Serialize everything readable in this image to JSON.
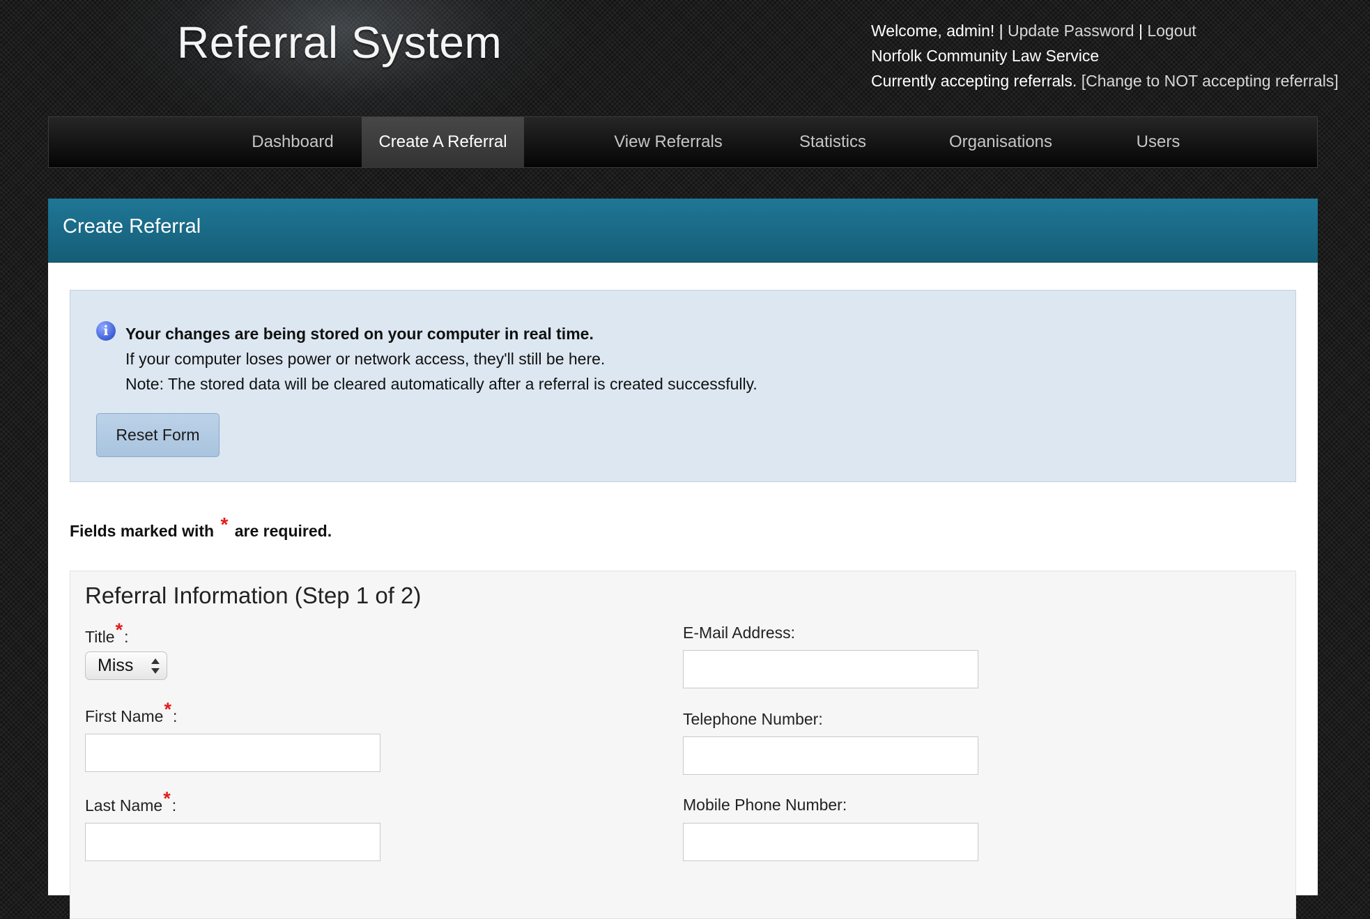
{
  "header": {
    "site_title": "Referral System",
    "welcome_text": "Welcome, admin!",
    "update_password_label": "Update Password",
    "logout_label": "Logout",
    "separator": "|",
    "organisation": "Norfolk Community Law Service",
    "accepting_status": "Currently accepting referrals.",
    "toggle_accepting_label": "[Change to NOT accepting referrals]"
  },
  "nav": {
    "items": [
      {
        "label": "Dashboard"
      },
      {
        "label": "Create A Referral",
        "active": true
      },
      {
        "label": "View Referrals"
      },
      {
        "label": "Statistics"
      },
      {
        "label": "Organisations"
      },
      {
        "label": "Users"
      }
    ]
  },
  "panel": {
    "title": "Create Referral"
  },
  "info_box": {
    "icon": "info-icon",
    "icon_glyph": "i",
    "headline": "Your changes are being stored on your computer in real time.",
    "line2": "If your computer loses power or network access, they'll still be here.",
    "line3": "Note: The stored data will be cleared automatically after a referral is created successfully.",
    "reset_button_label": "Reset Form"
  },
  "required_note": {
    "before": "Fields marked with",
    "star": "*",
    "after": "are required."
  },
  "form": {
    "section_title": "Referral Information (Step 1 of 2)",
    "title_field": {
      "label": "Title",
      "star": "*",
      "colon": ":",
      "selected": "Miss"
    },
    "first_name": {
      "label": "First Name",
      "star": "*",
      "colon": ":",
      "value": ""
    },
    "last_name": {
      "label": "Last Name",
      "star": "*",
      "colon": ":",
      "value": ""
    },
    "email": {
      "label": "E-Mail Address:",
      "value": ""
    },
    "telephone": {
      "label": "Telephone Number:",
      "value": ""
    },
    "mobile": {
      "label": "Mobile Phone Number:",
      "value": ""
    }
  },
  "colors": {
    "panel_header": "#1a6d8b",
    "info_bg": "#dce7f1",
    "required_star": "#e31b1b"
  }
}
